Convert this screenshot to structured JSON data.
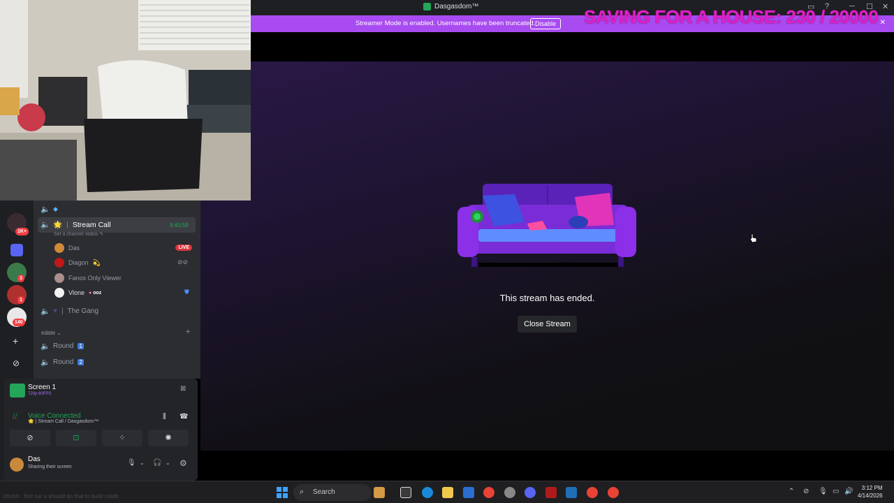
{
  "window": {
    "title": "Dasgasdom™",
    "controls": [
      "▭",
      "?",
      "─",
      "☐",
      "✕"
    ]
  },
  "banner": {
    "message": "Streamer Mode is enabled. Usernames have been truncated.",
    "button": "Disable",
    "close": "✕",
    "color": "#a84bf0"
  },
  "overlay": {
    "goal_text": "SAVING FOR A HOUSE: 230 / 20000",
    "goal_color": "#e020c8"
  },
  "stream": {
    "ended_message": "This stream has ended.",
    "close_button": "Close Stream"
  },
  "server_rail": {
    "badges": [
      "1K+",
      "3",
      "1",
      "140"
    ],
    "add_glyph": "+",
    "explore_glyph": "⊘"
  },
  "channels": {
    "active_channel": {
      "icon": "🔈",
      "emoji": "🌟",
      "name": "Stream Call",
      "timer": "9:40:58",
      "status_placeholder": "Set a channel status ✎"
    },
    "users": [
      {
        "name": "Das",
        "badge": "LIVE"
      },
      {
        "name": "Diagon",
        "suffix": "💫"
      },
      {
        "name": "Fanos Only Viewer"
      },
      {
        "name": "Vlone",
        "suffix": "ooz"
      }
    ],
    "gang_channel": "The Gang",
    "category": "edate ⌄",
    "category_add": "+",
    "rounds": [
      {
        "name": "Round",
        "num": "1"
      },
      {
        "name": "Round",
        "num": "2"
      }
    ]
  },
  "panel": {
    "screen_title": "Screen 1",
    "screen_sub": "720p 60FPS",
    "voice_status": "Voice Connected",
    "voice_sub": "🌟 | Stream Call / Dasgasdom™",
    "user_name": "Das",
    "user_status": "Sharing their screen"
  },
  "taskbar": {
    "chat_overlay": "cfnchh : first car u should do that to build credit",
    "search_placeholder": "Search",
    "time": "3:12 PM",
    "date": "4/14/2026"
  }
}
